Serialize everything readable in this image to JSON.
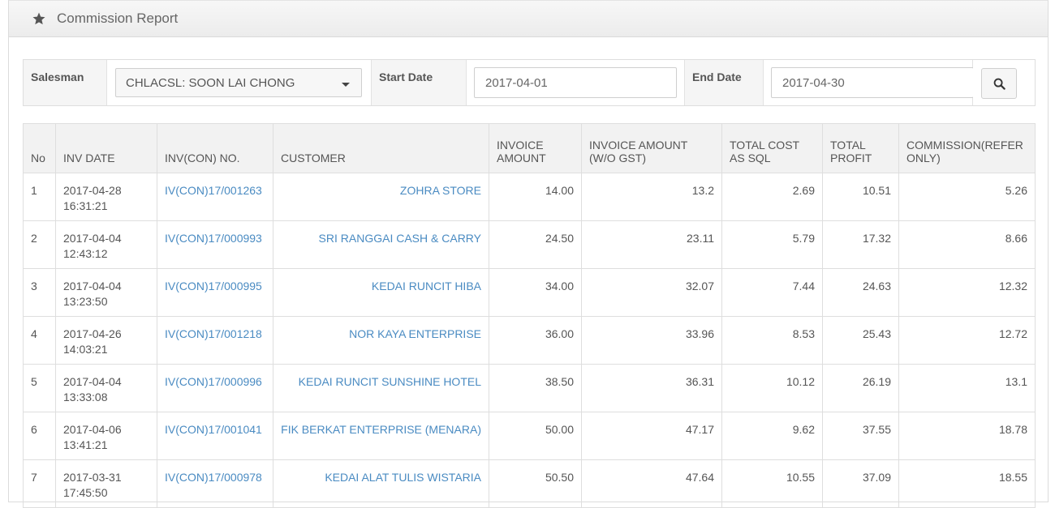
{
  "header": {
    "title": "Commission Report",
    "icon": "star-icon"
  },
  "filters": {
    "salesman_label": "Salesman",
    "salesman_value": "CHLACSL: SOON LAI CHONG",
    "start_label": "Start Date",
    "start_value": "2017-04-01",
    "end_label": "End Date",
    "end_value": "2017-04-30",
    "search_icon": "search-icon"
  },
  "table": {
    "headers": {
      "no": "No",
      "date": "INV DATE",
      "inv": "INV(CON) NO.",
      "customer": "CUSTOMER",
      "amount1": "INVOICE",
      "amount2": "AMOUNT",
      "amount_wo1": "INVOICE AMOUNT",
      "amount_wo2": "(W/O GST)",
      "cost1": "TOTAL COST",
      "cost2": "AS SQL",
      "profit1": "TOTAL",
      "profit2": "PROFIT",
      "comm1": "COMMISSION(REFER",
      "comm2": "ONLY)"
    },
    "rows": [
      {
        "no": "1",
        "date": "2017-04-28",
        "time": "16:31:21",
        "inv": "IV(CON)17/001263",
        "customer": "ZOHRA STORE",
        "amount": "14.00",
        "amount_wo": "13.2",
        "cost": "2.69",
        "profit": "10.51",
        "comm": "5.26"
      },
      {
        "no": "2",
        "date": "2017-04-04",
        "time": "12:43:12",
        "inv": "IV(CON)17/000993",
        "customer": "SRI RANGGAI CASH & CARRY",
        "amount": "24.50",
        "amount_wo": "23.11",
        "cost": "5.79",
        "profit": "17.32",
        "comm": "8.66"
      },
      {
        "no": "3",
        "date": "2017-04-04",
        "time": "13:23:50",
        "inv": "IV(CON)17/000995",
        "customer": "KEDAI RUNCIT HIBA",
        "amount": "34.00",
        "amount_wo": "32.07",
        "cost": "7.44",
        "profit": "24.63",
        "comm": "12.32"
      },
      {
        "no": "4",
        "date": "2017-04-26",
        "time": "14:03:21",
        "inv": "IV(CON)17/001218",
        "customer": "NOR KAYA ENTERPRISE",
        "amount": "36.00",
        "amount_wo": "33.96",
        "cost": "8.53",
        "profit": "25.43",
        "comm": "12.72"
      },
      {
        "no": "5",
        "date": "2017-04-04",
        "time": "13:33:08",
        "inv": "IV(CON)17/000996",
        "customer": "KEDAI RUNCIT SUNSHINE HOTEL",
        "amount": "38.50",
        "amount_wo": "36.31",
        "cost": "10.12",
        "profit": "26.19",
        "comm": "13.1"
      },
      {
        "no": "6",
        "date": "2017-04-06",
        "time": "13:41:21",
        "inv": "IV(CON)17/001041",
        "customer": "FIK BERKAT ENTERPRISE (MENARA)",
        "amount": "50.00",
        "amount_wo": "47.17",
        "cost": "9.62",
        "profit": "37.55",
        "comm": "18.78"
      },
      {
        "no": "7",
        "date": "2017-03-31",
        "time": "17:45:50",
        "inv": "IV(CON)17/000978",
        "customer": "KEDAI ALAT TULIS WISTARIA",
        "amount": "50.50",
        "amount_wo": "47.64",
        "cost": "10.55",
        "profit": "37.09",
        "comm": "18.55"
      }
    ]
  }
}
